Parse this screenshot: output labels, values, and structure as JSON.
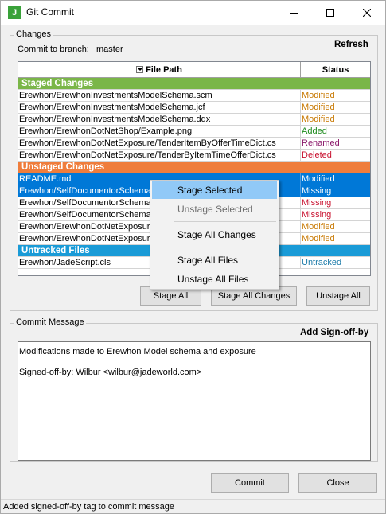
{
  "window": {
    "title": "Git Commit",
    "app_icon_letter": "J",
    "minimize_glyph": "—",
    "maximize_glyph": "☐",
    "close_glyph": "✕"
  },
  "changes": {
    "group_label": "Changes",
    "branch_label": "Commit to branch:",
    "branch_name": "master",
    "refresh_label": "Refresh",
    "columns": [
      "File Path",
      "Status"
    ],
    "sections": [
      {
        "title": "Staged Changes",
        "color": "#7ab648",
        "rows": [
          {
            "path": "Erewhon/ErewhonInvestmentsModelSchema.scm",
            "status": "Modified",
            "status_color": "#c87800"
          },
          {
            "path": "Erewhon/ErewhonInvestmentsModelSchema.jcf",
            "status": "Modified",
            "status_color": "#c87800"
          },
          {
            "path": "Erewhon/ErewhonInvestmentsModelSchema.ddx",
            "status": "Modified",
            "status_color": "#c87800"
          },
          {
            "path": "Erewhon/ErewhonDotNetShop/Example.png",
            "status": "Added",
            "status_color": "#1b8a1b"
          },
          {
            "path": "Erewhon/ErewhonDotNetExposure/TenderItemByOfferTimeDict.cs",
            "status": "Renamed",
            "status_color": "#8b1a6b"
          },
          {
            "path": "Erewhon/ErewhonDotNetExposure/TenderByItemTimeOfferDict.cs",
            "status": "Deleted",
            "status_color": "#c8102e"
          }
        ]
      },
      {
        "title": "Unstaged Changes",
        "color": "#ef7d3c",
        "rows": [
          {
            "path": "README.md",
            "status": "Modified",
            "status_color": "#c87800",
            "selected": true
          },
          {
            "path": "Erewhon/SelfDocumentorSchema.scm",
            "status": "Missing",
            "status_color": "#c8102e",
            "selected": true
          },
          {
            "path": "Erewhon/SelfDocumentorSchema.jcf",
            "status": "Missing",
            "status_color": "#c8102e"
          },
          {
            "path": "Erewhon/SelfDocumentorSchema.ddx",
            "status": "Missing",
            "status_color": "#c8102e"
          },
          {
            "path": "Erewhon/ErewhonDotNetExposure/Program.cs",
            "status": "Modified",
            "status_color": "#c87800"
          },
          {
            "path": "Erewhon/ErewhonDotNetExposure/Schema.cs",
            "status": "Modified",
            "status_color": "#c87800"
          }
        ]
      },
      {
        "title": "Untracked Files",
        "color": "#1a9bd7",
        "rows": [
          {
            "path": "Erewhon/JadeScript.cls",
            "status": "Untracked",
            "status_color": "#1a7aa8"
          }
        ]
      }
    ],
    "buttons": {
      "stage_all": "Stage All",
      "stage_all_changes": "Stage All Changes",
      "unstage_all": "Unstage All"
    }
  },
  "context_menu": {
    "items": [
      {
        "label": "Stage Selected",
        "state": "hover"
      },
      {
        "label": "Unstage Selected",
        "state": "disabled"
      },
      {
        "label": "Stage All Changes",
        "state": "normal"
      },
      {
        "label": "Stage All Files",
        "state": "normal"
      },
      {
        "label": "Unstage All Files",
        "state": "normal"
      }
    ]
  },
  "commit_message": {
    "group_label": "Commit Message",
    "signoff_label": "Add Sign-off-by",
    "lines": [
      "Modifications made to Erewhon Model schema and exposure",
      "",
      "Signed-off-by: Wilbur <wilbur@jadeworld.com>"
    ]
  },
  "footer": {
    "commit_label": "Commit",
    "close_label": "Close",
    "status_text": "Added signed-off-by tag to commit message"
  }
}
